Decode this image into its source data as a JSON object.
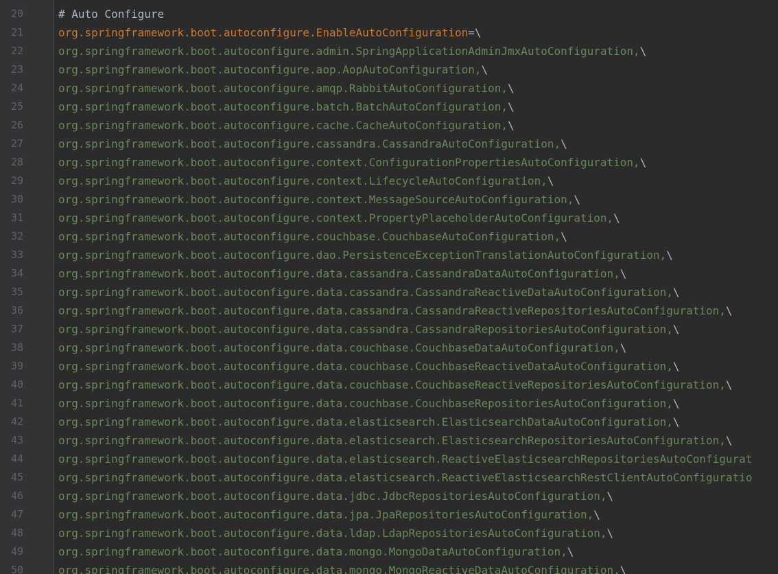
{
  "editor": {
    "first_line_number": 20,
    "colors": {
      "background": "#2b2b2b",
      "gutter": "#313335",
      "line_number": "#606366",
      "comment": "#a9b7c6",
      "key": "#cc7832",
      "value": "#6a8759"
    },
    "lines": [
      {
        "num": "20",
        "kind": "comment",
        "text": "# Auto Configure"
      },
      {
        "num": "21",
        "kind": "key",
        "key": "org.springframework.boot.autoconfigure.EnableAutoConfiguration",
        "sep": "=",
        "cont": "\\"
      },
      {
        "num": "22",
        "kind": "value",
        "value": "org.springframework.boot.autoconfigure.admin.SpringApplicationAdminJmxAutoConfiguration,",
        "cont": "\\"
      },
      {
        "num": "23",
        "kind": "value",
        "value": "org.springframework.boot.autoconfigure.aop.AopAutoConfiguration,",
        "cont": "\\"
      },
      {
        "num": "24",
        "kind": "value",
        "value": "org.springframework.boot.autoconfigure.amqp.RabbitAutoConfiguration,",
        "cont": "\\"
      },
      {
        "num": "25",
        "kind": "value",
        "value": "org.springframework.boot.autoconfigure.batch.BatchAutoConfiguration,",
        "cont": "\\"
      },
      {
        "num": "26",
        "kind": "value",
        "value": "org.springframework.boot.autoconfigure.cache.CacheAutoConfiguration,",
        "cont": "\\"
      },
      {
        "num": "27",
        "kind": "value",
        "value": "org.springframework.boot.autoconfigure.cassandra.CassandraAutoConfiguration,",
        "cont": "\\"
      },
      {
        "num": "28",
        "kind": "value",
        "value": "org.springframework.boot.autoconfigure.context.ConfigurationPropertiesAutoConfiguration,",
        "cont": "\\"
      },
      {
        "num": "29",
        "kind": "value",
        "value": "org.springframework.boot.autoconfigure.context.LifecycleAutoConfiguration,",
        "cont": "\\"
      },
      {
        "num": "30",
        "kind": "value",
        "value": "org.springframework.boot.autoconfigure.context.MessageSourceAutoConfiguration,",
        "cont": "\\"
      },
      {
        "num": "31",
        "kind": "value",
        "value": "org.springframework.boot.autoconfigure.context.PropertyPlaceholderAutoConfiguration,",
        "cont": "\\"
      },
      {
        "num": "32",
        "kind": "value",
        "value": "org.springframework.boot.autoconfigure.couchbase.CouchbaseAutoConfiguration,",
        "cont": "\\"
      },
      {
        "num": "33",
        "kind": "value",
        "value": "org.springframework.boot.autoconfigure.dao.PersistenceExceptionTranslationAutoConfiguration,",
        "cont": "\\"
      },
      {
        "num": "34",
        "kind": "value",
        "value": "org.springframework.boot.autoconfigure.data.cassandra.CassandraDataAutoConfiguration,",
        "cont": "\\"
      },
      {
        "num": "35",
        "kind": "value",
        "value": "org.springframework.boot.autoconfigure.data.cassandra.CassandraReactiveDataAutoConfiguration,",
        "cont": "\\"
      },
      {
        "num": "36",
        "kind": "value",
        "value": "org.springframework.boot.autoconfigure.data.cassandra.CassandraReactiveRepositoriesAutoConfiguration,",
        "cont": "\\"
      },
      {
        "num": "37",
        "kind": "value",
        "value": "org.springframework.boot.autoconfigure.data.cassandra.CassandraRepositoriesAutoConfiguration,",
        "cont": "\\"
      },
      {
        "num": "38",
        "kind": "value",
        "value": "org.springframework.boot.autoconfigure.data.couchbase.CouchbaseDataAutoConfiguration,",
        "cont": "\\"
      },
      {
        "num": "39",
        "kind": "value",
        "value": "org.springframework.boot.autoconfigure.data.couchbase.CouchbaseReactiveDataAutoConfiguration,",
        "cont": "\\"
      },
      {
        "num": "40",
        "kind": "value",
        "value": "org.springframework.boot.autoconfigure.data.couchbase.CouchbaseReactiveRepositoriesAutoConfiguration,",
        "cont": "\\"
      },
      {
        "num": "41",
        "kind": "value",
        "value": "org.springframework.boot.autoconfigure.data.couchbase.CouchbaseRepositoriesAutoConfiguration,",
        "cont": "\\"
      },
      {
        "num": "42",
        "kind": "value",
        "value": "org.springframework.boot.autoconfigure.data.elasticsearch.ElasticsearchDataAutoConfiguration,",
        "cont": "\\"
      },
      {
        "num": "43",
        "kind": "value",
        "value": "org.springframework.boot.autoconfigure.data.elasticsearch.ElasticsearchRepositoriesAutoConfiguration,",
        "cont": "\\"
      },
      {
        "num": "44",
        "kind": "value",
        "value": "org.springframework.boot.autoconfigure.data.elasticsearch.ReactiveElasticsearchRepositoriesAutoConfigurat",
        "cont": ""
      },
      {
        "num": "45",
        "kind": "value",
        "value": "org.springframework.boot.autoconfigure.data.elasticsearch.ReactiveElasticsearchRestClientAutoConfiguratio",
        "cont": ""
      },
      {
        "num": "46",
        "kind": "value",
        "value": "org.springframework.boot.autoconfigure.data.jdbc.JdbcRepositoriesAutoConfiguration,",
        "cont": "\\"
      },
      {
        "num": "47",
        "kind": "value",
        "value": "org.springframework.boot.autoconfigure.data.jpa.JpaRepositoriesAutoConfiguration,",
        "cont": "\\"
      },
      {
        "num": "48",
        "kind": "value",
        "value": "org.springframework.boot.autoconfigure.data.ldap.LdapRepositoriesAutoConfiguration,",
        "cont": "\\"
      },
      {
        "num": "49",
        "kind": "value",
        "value": "org.springframework.boot.autoconfigure.data.mongo.MongoDataAutoConfiguration,",
        "cont": "\\"
      },
      {
        "num": "50",
        "kind": "value",
        "value": "org.springframework.boot.autoconfigure.data.mongo.MongoReactiveDataAutoConfiguration,",
        "cont": "\\"
      }
    ]
  }
}
